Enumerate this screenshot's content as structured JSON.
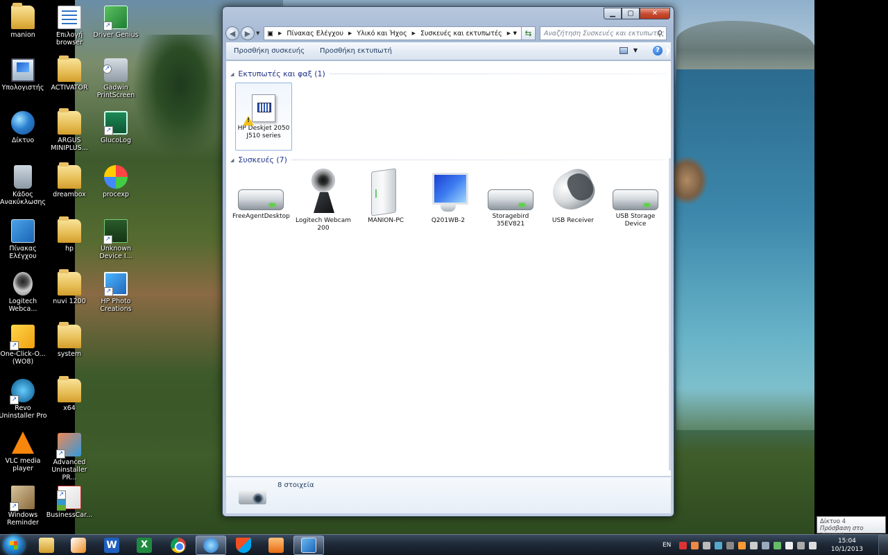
{
  "desktop": {
    "icons": [
      {
        "label": "manion"
      },
      {
        "label": "Επιλογή browser"
      },
      {
        "label": "Driver Genius"
      },
      {
        "label": "Υπολογιστής"
      },
      {
        "label": "ACTIVATOR"
      },
      {
        "label": "Gadwin PrintScreen"
      },
      {
        "label": "Δίκτυο"
      },
      {
        "label": "ARGUS MINIPLUS..."
      },
      {
        "label": "GlucoLog"
      },
      {
        "label": "Κάδος Ανακύκλωσης"
      },
      {
        "label": "dreambox"
      },
      {
        "label": "procexp"
      },
      {
        "label": "Πίνακας Ελέγχου"
      },
      {
        "label": "hp"
      },
      {
        "label": "Unknown Device I..."
      },
      {
        "label": "Logitech Webca..."
      },
      {
        "label": "nuvi 1200"
      },
      {
        "label": "HP Photo Creations"
      },
      {
        "label": "One-Click-O... (WO8)"
      },
      {
        "label": "system"
      },
      {
        "label": "Revo Uninstaller Pro"
      },
      {
        "label": "x64"
      },
      {
        "label": "VLC media player"
      },
      {
        "label": "Advanced Uninstaller PR..."
      },
      {
        "label": "Windows Reminder"
      },
      {
        "label": "BusinessCar..."
      }
    ]
  },
  "window": {
    "breadcrumbs": [
      "Πίνακας Ελέγχου",
      "Υλικό και Ήχος",
      "Συσκευές και εκτυπωτές"
    ],
    "search_placeholder": "Αναζήτηση Συσκευές και εκτυπωτές",
    "toolbar": {
      "add_device": "Προσθήκη συσκευής",
      "add_printer": "Προσθήκη εκτυπωτή"
    },
    "groups": {
      "printers": {
        "title": "Εκτυπωτές και φαξ (1)",
        "items": [
          {
            "label": "HP Deskjet 2050 J510 series"
          }
        ]
      },
      "devices": {
        "title": "Συσκευές (7)",
        "items": [
          {
            "label": "FreeAgentDesktop"
          },
          {
            "label": "Logitech Webcam 200"
          },
          {
            "label": "MANION-PC"
          },
          {
            "label": "Q201WB-2"
          },
          {
            "label": "Storagebird 35EV821"
          },
          {
            "label": "USB Receiver"
          },
          {
            "label": "USB Storage Device"
          }
        ]
      }
    },
    "details": {
      "count": "8 στοιχεία"
    }
  },
  "tooltip": {
    "line1": "Δίκτυο  4",
    "line2": "Πρόσβαση στο Internet"
  },
  "taskbar": {
    "lang": "EN",
    "time": "15:04",
    "date": "10/1/2013"
  }
}
